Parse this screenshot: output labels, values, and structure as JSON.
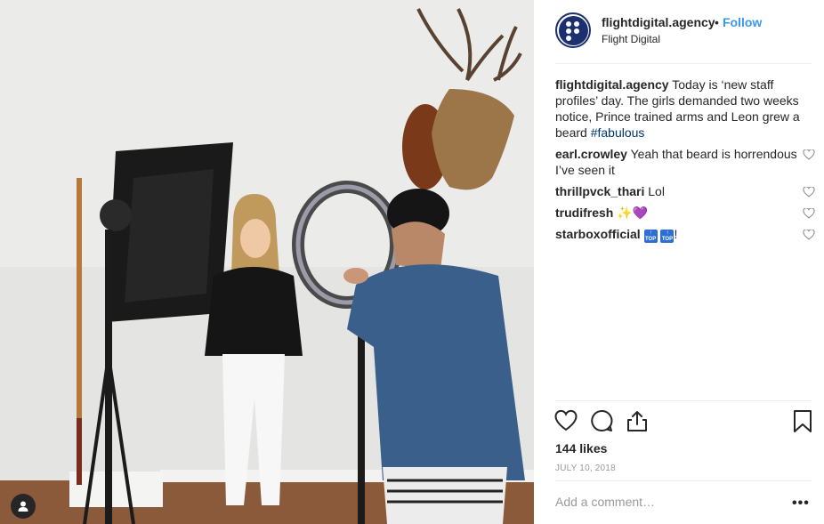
{
  "post": {
    "username": "flightdigital.agency",
    "separator": "•",
    "follow_label": "Follow",
    "location": "Flight Digital",
    "caption_user": "flightdigital.agency",
    "caption_text": " Today is ‘new staff profiles’ day. The girls demanded two weeks notice, Prince trained arms and Leon grew a beard ",
    "caption_hashtag": "#fabulous",
    "likes": "144 likes",
    "date": "JULY 10, 2018",
    "add_comment_placeholder": "Add a comment…",
    "more_label": "•••"
  },
  "comments": [
    {
      "user": "earl.crowley",
      "text": " Yeah that beard is horrendous I’ve seen it"
    },
    {
      "user": "thrillpvck_thari",
      "text": " Lol"
    },
    {
      "user": "trudifresh",
      "text": " "
    },
    {
      "user": "starboxofficial",
      "text": " "
    }
  ],
  "emoji": {
    "sparkle": "✨",
    "purple_heart": "💜",
    "top_badge": "TOP",
    "exclaim": "!"
  },
  "icons": {
    "like": "heart-icon",
    "comment": "comment-bubble-icon",
    "share": "share-icon",
    "save": "bookmark-icon",
    "tag": "user-tag-icon"
  },
  "colors": {
    "follow": "#3897f0",
    "hashtag": "#003569",
    "brand_navy": "#1c2f6e",
    "muted": "#999999"
  }
}
